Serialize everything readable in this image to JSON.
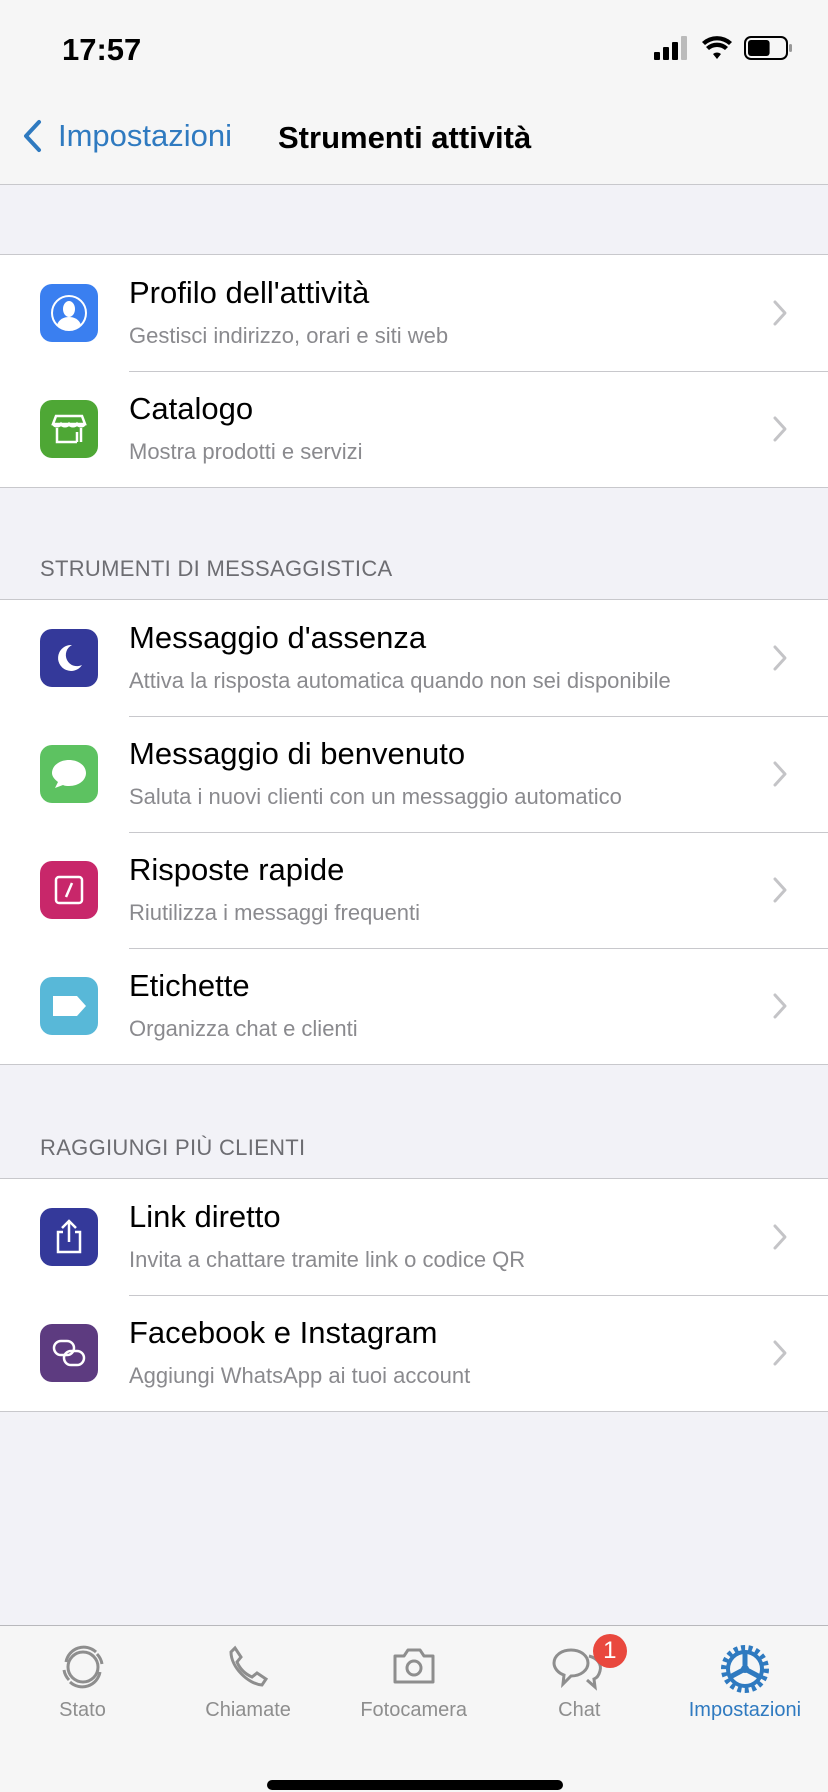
{
  "status_bar": {
    "time": "17:57",
    "battery_level": 0.6
  },
  "nav": {
    "back_label": "Impostazioni",
    "title": "Strumenti attività"
  },
  "groups": [
    {
      "header": "",
      "items": [
        {
          "title": "Profilo dell'attività",
          "subtitle": "Gestisci indirizzo, orari e siti web",
          "icon": "person-icon",
          "color": "#3a7ff0"
        },
        {
          "title": "Catalogo",
          "subtitle": "Mostra prodotti e servizi",
          "icon": "storefront-icon",
          "color": "#4ea735"
        }
      ]
    },
    {
      "header": "STRUMENTI DI MESSAGGISTICA",
      "items": [
        {
          "title": "Messaggio d'assenza",
          "subtitle": "Attiva la risposta automatica quando non sei disponibile",
          "icon": "moon-icon",
          "color": "#34399a"
        },
        {
          "title": "Messaggio di benvenuto",
          "subtitle": "Saluta i nuovi clienti con un messaggio automatico",
          "icon": "chat-bubble-icon",
          "color": "#5dc261"
        },
        {
          "title": "Risposte rapide",
          "subtitle": "Riutilizza i messaggi frequenti",
          "icon": "quick-reply-icon",
          "color": "#c8276a"
        },
        {
          "title": "Etichette",
          "subtitle": "Organizza chat e clienti",
          "icon": "label-icon",
          "color": "#58b8d8"
        }
      ]
    },
    {
      "header": "RAGGIUNGI PIÙ CLIENTI",
      "items": [
        {
          "title": "Link diretto",
          "subtitle": "Invita a chattare tramite link o codice QR",
          "icon": "share-icon",
          "color": "#34399a"
        },
        {
          "title": "Facebook e Instagram",
          "subtitle": "Aggiungi WhatsApp ai tuoi account",
          "icon": "link-icon",
          "color": "#5d3b80"
        }
      ]
    }
  ],
  "tabs": [
    {
      "label": "Stato",
      "icon": "status-icon"
    },
    {
      "label": "Chiamate",
      "icon": "phone-icon"
    },
    {
      "label": "Fotocamera",
      "icon": "camera-icon"
    },
    {
      "label": "Chat",
      "icon": "chats-icon",
      "badge": "1"
    },
    {
      "label": "Impostazioni",
      "icon": "settings-gear-icon",
      "active": true
    }
  ],
  "colors": {
    "accent": "#2f7ac0",
    "badge": "#e9483e"
  }
}
